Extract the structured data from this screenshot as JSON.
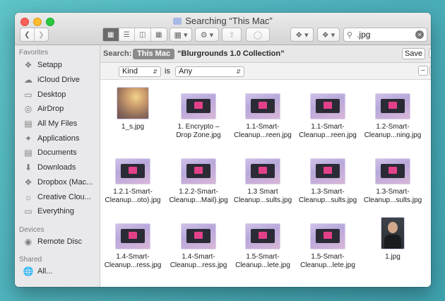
{
  "window": {
    "title": "Searching “This Mac”"
  },
  "toolbar": {
    "search_value": ".jpg",
    "clear_glyph": "×"
  },
  "sidebar": {
    "favorites_header": "Favorites",
    "favorites": [
      {
        "label": "Setapp",
        "icon": "setapp-icon"
      },
      {
        "label": "iCloud Drive",
        "icon": "cloud-icon"
      },
      {
        "label": "Desktop",
        "icon": "desktop-icon"
      },
      {
        "label": "AirDrop",
        "icon": "airdrop-icon"
      },
      {
        "label": "All My Files",
        "icon": "all-files-icon"
      },
      {
        "label": "Applications",
        "icon": "applications-icon"
      },
      {
        "label": "Documents",
        "icon": "documents-icon"
      },
      {
        "label": "Downloads",
        "icon": "downloads-icon"
      },
      {
        "label": "Dropbox (Mac...",
        "icon": "dropbox-icon"
      },
      {
        "label": "Creative Clou...",
        "icon": "creative-cloud-icon"
      },
      {
        "label": "Everything",
        "icon": "folder-icon"
      }
    ],
    "devices_header": "Devices",
    "devices": [
      {
        "label": "Remote Disc",
        "icon": "disc-icon"
      }
    ],
    "shared_header": "Shared",
    "shared": [
      {
        "label": "All...",
        "icon": "network-icon"
      }
    ]
  },
  "searchbar": {
    "label": "Search:",
    "scope_selected": "This Mac",
    "scope_other": "“Blurgrounds 1.0 Collection”",
    "save_label": "Save",
    "remove_label": "−"
  },
  "criteria": {
    "attribute": "Kind",
    "operator": "is",
    "value": "Any",
    "remove_label": "−",
    "add_label": "+"
  },
  "files": [
    {
      "name1": "1_s.jpg",
      "name2": "",
      "thumb": "photo"
    },
    {
      "name1": "1. Encrypto –",
      "name2": "Drop Zone.jpg",
      "thumb": "app"
    },
    {
      "name1": "1.1-Smart-",
      "name2": "Cleanup...reen.jpg",
      "thumb": "app"
    },
    {
      "name1": "1.1-Smart-",
      "name2": "Cleanup...reen.jpg",
      "thumb": "app"
    },
    {
      "name1": "1.2-Smart-",
      "name2": "Cleanup...ning.jpg",
      "thumb": "app"
    },
    {
      "name1": "1.2.1-Smart-",
      "name2": "Cleanup...oto).jpg",
      "thumb": "app"
    },
    {
      "name1": "1.2.2-Smart-",
      "name2": "Cleanup...Mail).jpg",
      "thumb": "app"
    },
    {
      "name1": "1.3 Smart",
      "name2": "Cleanup...sults.jpg",
      "thumb": "app"
    },
    {
      "name1": "1.3-Smart-",
      "name2": "Cleanup...sults.jpg",
      "thumb": "app"
    },
    {
      "name1": "1.3-Smart-",
      "name2": "Cleanup...sults.jpg",
      "thumb": "app"
    },
    {
      "name1": "1.4-Smart-",
      "name2": "Cleanup...ress.jpg",
      "thumb": "app"
    },
    {
      "name1": "1.4-Smart-",
      "name2": "Cleanup...ress.jpg",
      "thumb": "app"
    },
    {
      "name1": "1.5-Smart-",
      "name2": "Cleanup...lete.jpg",
      "thumb": "app"
    },
    {
      "name1": "1.5-Smart-",
      "name2": "Cleanup...lete.jpg",
      "thumb": "app"
    },
    {
      "name1": "1.jpg",
      "name2": "",
      "thumb": "portrait"
    }
  ]
}
